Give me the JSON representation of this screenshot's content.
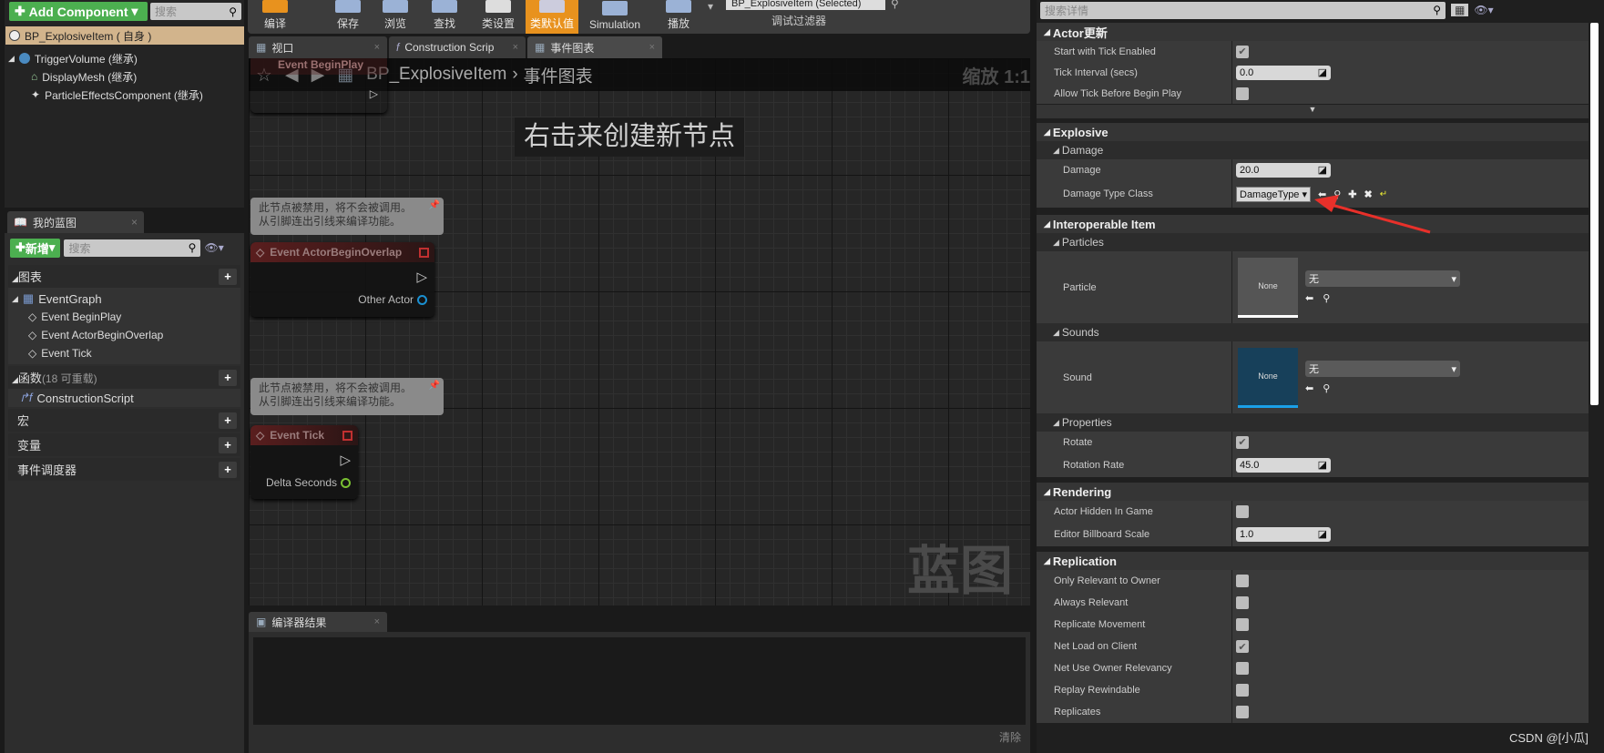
{
  "components": {
    "add_label": "Add Component",
    "search_placeholder": "搜索",
    "root": "BP_ExplosiveItem ( 自身 )",
    "items": [
      "TriggerVolume (继承)",
      "DisplayMesh (继承)",
      "ParticleEffectsComponent (继承)"
    ]
  },
  "my_blueprint": {
    "tab": "我的蓝图",
    "new_label": "新增",
    "search_placeholder": "搜索",
    "graphs_label": "图表",
    "event_graph": "EventGraph",
    "events": [
      "Event BeginPlay",
      "Event ActorBeginOverlap",
      "Event Tick"
    ],
    "functions_label": "函数",
    "functions_count": "(18 可重载)",
    "construction": "ConstructionScript",
    "macros": "宏",
    "variables": "变量",
    "dispatchers": "事件调度器"
  },
  "toolbar": {
    "buttons": [
      "编译",
      "保存",
      "浏览",
      "查找",
      "类设置",
      "类默认值",
      "Simulation",
      "播放"
    ],
    "active_index": 5,
    "active_color": "#e8921e",
    "debug_filter_value": "BP_ExplosiveItem (Selected)",
    "debug_filter_label": "调试过滤器"
  },
  "tabs": [
    {
      "label": "视口"
    },
    {
      "label": "Construction Scrip"
    },
    {
      "label": "事件图表"
    }
  ],
  "graph": {
    "breadcrumb_root": "BP_ExplosiveItem",
    "breadcrumb_current": "事件图表",
    "zoom": "缩放 1:1",
    "hint": "右击来创建新节点",
    "watermark": "蓝图",
    "hidden_node": "Event BeginPlay",
    "comment": [
      "此节点被禁用，将不会被调用。",
      "从引脚连出引线来编译功能。"
    ],
    "nodes": [
      {
        "title": "Event ActorBeginOverlap",
        "pin": "Other Actor",
        "pin_color": "#1a8fd0"
      },
      {
        "title": "Event Tick",
        "pin": "Delta Seconds",
        "pin_color": "#7ac032"
      }
    ]
  },
  "compiler": {
    "tab": "编译器结果",
    "clear": "清除"
  },
  "details": {
    "search_placeholder": "搜索详情",
    "actor_tick": {
      "title": "Actor更新",
      "start_tick": "Start with Tick Enabled",
      "start_tick_checked": true,
      "interval_label": "Tick Interval (secs)",
      "interval": "0.0",
      "allow_tick": "Allow Tick Before Begin Play",
      "allow_tick_checked": false
    },
    "explosive": {
      "title": "Explosive",
      "sub": "Damage",
      "damage_label": "Damage",
      "damage": "20.0",
      "type_label": "Damage Type Class",
      "type": "DamageType"
    },
    "interop": {
      "title": "Interoperable Item",
      "particles": "Particles",
      "particle_label": "Particle",
      "none": "None",
      "combo": "无",
      "sounds": "Sounds",
      "sound_label": "Sound",
      "properties": "Properties",
      "rotate_label": "Rotate",
      "rotate_checked": true,
      "rate_label": "Rotation Rate",
      "rate": "45.0"
    },
    "rendering": {
      "title": "Rendering",
      "hidden_label": "Actor Hidden In Game",
      "hidden_checked": false,
      "billboard_label": "Editor Billboard Scale",
      "billboard": "1.0"
    },
    "replication": {
      "title": "Replication",
      "rows": [
        {
          "label": "Only Relevant to Owner",
          "checked": false
        },
        {
          "label": "Always Relevant",
          "checked": false
        },
        {
          "label": "Replicate Movement",
          "checked": false
        },
        {
          "label": "Net Load on Client",
          "checked": true
        },
        {
          "label": "Net Use Owner Relevancy",
          "checked": false
        },
        {
          "label": "Replay Rewindable",
          "checked": false
        },
        {
          "label": "Replicates",
          "checked": false
        }
      ]
    }
  },
  "watermark": "CSDN @[小瓜]",
  "annotation_color": "#e8302a"
}
